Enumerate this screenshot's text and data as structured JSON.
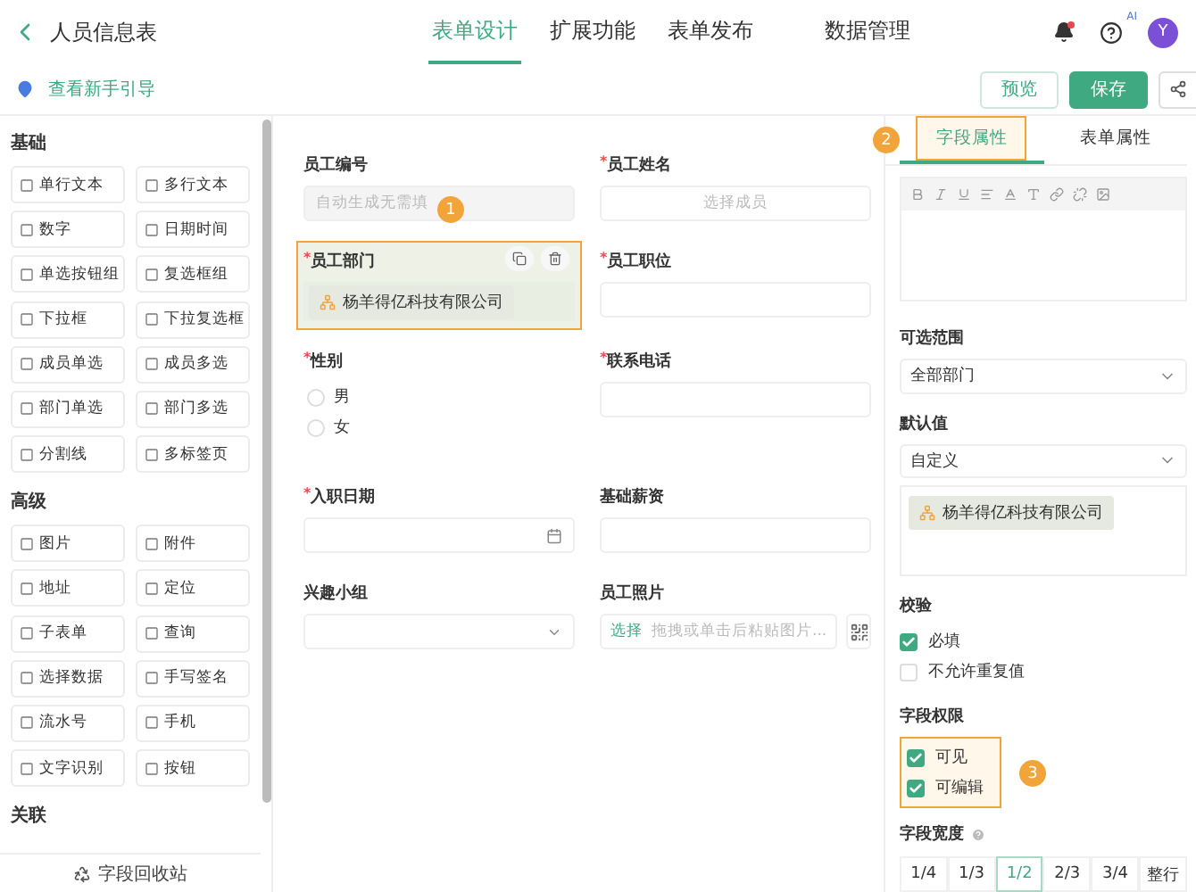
{
  "header": {
    "title": "人员信息表",
    "tabs": [
      {
        "label": "表单设计",
        "selected": true
      },
      {
        "label": "扩展功能",
        "selected": false
      },
      {
        "label": "表单发布",
        "selected": false
      },
      {
        "label": "数据管理",
        "selected": false
      }
    ],
    "help_badge": "AI",
    "avatar": "Y"
  },
  "subbar": {
    "guide": "查看新手引导",
    "buttons": [
      {
        "label": "预览",
        "kind": "secondary"
      },
      {
        "label": "保存",
        "kind": "primary"
      }
    ]
  },
  "palette": {
    "groups": [
      {
        "title": "基础",
        "items": [
          {
            "label": "单行文本"
          },
          {
            "label": "多行文本"
          },
          {
            "label": "数字"
          },
          {
            "label": "日期时间"
          },
          {
            "label": "单选按钮组"
          },
          {
            "label": "复选框组"
          },
          {
            "label": "下拉框"
          },
          {
            "label": "下拉复选框"
          },
          {
            "label": "成员单选"
          },
          {
            "label": "成员多选"
          },
          {
            "label": "部门单选"
          },
          {
            "label": "部门多选"
          },
          {
            "label": "分割线"
          },
          {
            "label": "多标签页"
          }
        ]
      },
      {
        "title": "高级",
        "items": [
          {
            "label": "图片"
          },
          {
            "label": "附件"
          },
          {
            "label": "地址"
          },
          {
            "label": "定位"
          },
          {
            "label": "子表单"
          },
          {
            "label": "查询"
          },
          {
            "label": "选择数据"
          },
          {
            "label": "手写签名"
          },
          {
            "label": "流水号"
          },
          {
            "label": "手机"
          },
          {
            "label": "文字识别"
          },
          {
            "label": "按钮"
          }
        ]
      },
      {
        "title": "关联"
      }
    ],
    "recycle": "字段回收站"
  },
  "form": {
    "required_mark": "*",
    "fields": [
      {
        "label": "员工编号",
        "required": false,
        "kind": "input",
        "placeholder": "自动生成无需填",
        "disabled": true,
        "selected": false,
        "callout": "1"
      },
      {
        "label": "员工姓名",
        "required": true,
        "kind": "member",
        "placeholder": "选择成员",
        "selected": false
      },
      {
        "label": "员工部门",
        "required": true,
        "kind": "dept",
        "value": "杨羊得亿科技有限公司",
        "selected": true
      },
      {
        "label": "员工职位",
        "required": true,
        "kind": "input",
        "selected": false
      },
      {
        "label": "性别",
        "required": true,
        "kind": "radio",
        "options": [
          {
            "label": "男",
            "checked": false
          },
          {
            "label": "女",
            "checked": false
          }
        ],
        "selected": false
      },
      {
        "label": "联系电话",
        "required": true,
        "kind": "input",
        "selected": false
      },
      {
        "label": "入职日期",
        "required": true,
        "kind": "date",
        "selected": false
      },
      {
        "label": "基础薪资",
        "required": false,
        "kind": "input",
        "selected": false
      },
      {
        "label": "兴趣小组",
        "required": false,
        "kind": "select",
        "selected": false
      },
      {
        "label": "员工照片",
        "required": false,
        "kind": "upload",
        "action": "选择",
        "placeholder": "拖拽或单击后粘贴图片...",
        "selected": false
      }
    ]
  },
  "properties": {
    "tabs": [
      {
        "label": "字段属性",
        "selected": true,
        "callout": "2"
      },
      {
        "label": "表单属性",
        "selected": false
      }
    ],
    "toolbar": [
      {
        "kind": "bold"
      },
      {
        "kind": "italic"
      },
      {
        "kind": "underline"
      },
      {
        "kind": "align"
      },
      {
        "kind": "color"
      },
      {
        "kind": "size"
      },
      {
        "kind": "link"
      },
      {
        "kind": "unlink"
      },
      {
        "kind": "image"
      }
    ],
    "range": {
      "label": "可选范围",
      "value": "全部部门"
    },
    "default": {
      "label": "默认值",
      "value": "自定义",
      "chip": "杨羊得亿科技有限公司"
    },
    "validation": {
      "label": "校验",
      "items": [
        {
          "label": "必填",
          "checked": true
        },
        {
          "label": "不允许重复值",
          "checked": false
        }
      ]
    },
    "permissions": {
      "label": "字段权限",
      "callout": "3",
      "items": [
        {
          "label": "可见",
          "checked": true
        },
        {
          "label": "可编辑",
          "checked": true
        }
      ]
    },
    "width": {
      "label": "字段宽度",
      "options": [
        {
          "label": "1/4",
          "selected": false
        },
        {
          "label": "1/3",
          "selected": false
        },
        {
          "label": "1/2",
          "selected": true
        },
        {
          "label": "2/3",
          "selected": false
        },
        {
          "label": "3/4",
          "selected": false
        },
        {
          "label": "整行",
          "selected": false
        }
      ]
    }
  }
}
